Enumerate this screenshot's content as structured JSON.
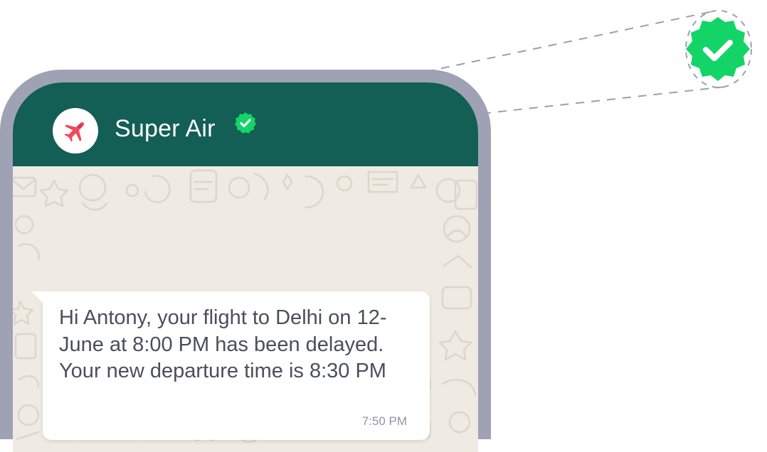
{
  "header": {
    "contact_name": "Super Air",
    "avatar_icon": "airplane-icon",
    "verified_icon": "verified-badge-icon"
  },
  "message": {
    "text": "Hi Antony, your flight to Delhi on 12-June at 8:00 PM has been delayed. Your new departure time is 8:30 PM",
    "time": "7:50 PM"
  },
  "callout": {
    "icon": "verified-badge-icon"
  },
  "colors": {
    "header_bg": "#135e55",
    "phone_frame": "#9fa2b4",
    "chat_bg": "#efeae2",
    "verified_green": "#13d567",
    "airplane_red": "#f2475a"
  }
}
